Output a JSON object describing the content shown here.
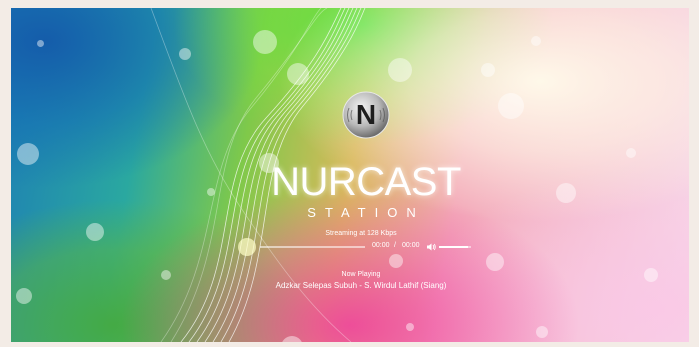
{
  "station": {
    "logo_letter": "N",
    "brand_name": "NURCAST",
    "subtitle": "STATION",
    "stream_info": "Streaming at 128 Kbps"
  },
  "player": {
    "time_current": "00:00",
    "time_separator": "/",
    "time_total": "00:00",
    "volume_level": 0.9,
    "progress": 0
  },
  "now_playing": {
    "label": "Now Playing",
    "title": "Adzkar Selepas Subuh - S. Wirdul Lathif (Siang)"
  },
  "icons": [
    "logo-n-icon",
    "volume-icon"
  ],
  "colors": {
    "text": "#ffffff"
  }
}
